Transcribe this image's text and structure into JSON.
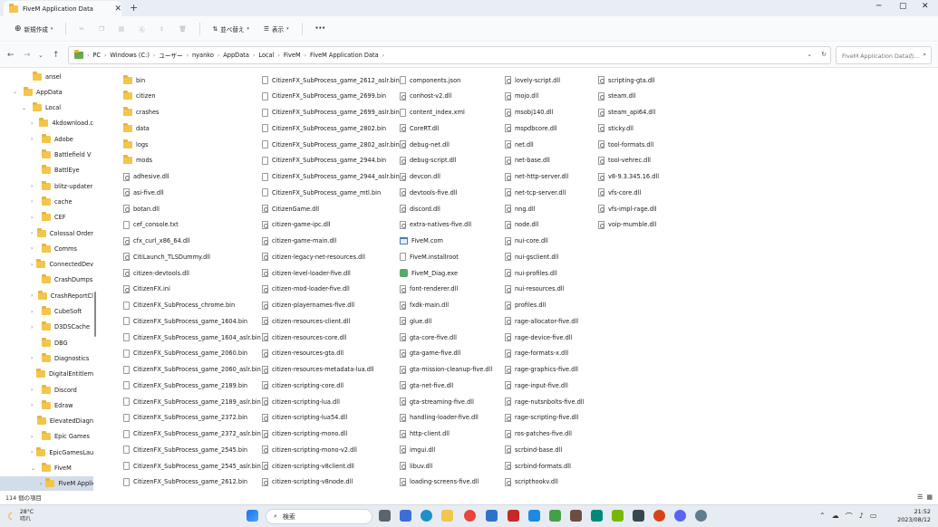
{
  "window": {
    "tab_title": "FiveM Application Data",
    "tab_close": "✕",
    "new_tab": "+",
    "minimize": "─",
    "maximize": "▢",
    "close": "✕"
  },
  "toolbar": {
    "new_label": "新規作成",
    "sort_label": "並べ替え",
    "view_label": "表示",
    "more": "···"
  },
  "address": {
    "crumbs": [
      "PC",
      "Windows (C:)",
      "ユーザー",
      "nyanko",
      "AppData",
      "Local",
      "FiveM",
      "FiveM Application Data"
    ],
    "search_placeholder": "FiveM Application Dataの..."
  },
  "sidebar": {
    "items": [
      {
        "label": "ansel",
        "level": 2,
        "expanded": false,
        "chev": false
      },
      {
        "label": "AppData",
        "level": 1,
        "expanded": true,
        "chev": true
      },
      {
        "label": "Local",
        "level": 2,
        "expanded": true,
        "chev": true
      },
      {
        "label": "4kdownload.c",
        "level": 3,
        "chev": true
      },
      {
        "label": "Adobe",
        "level": 3,
        "chev": true
      },
      {
        "label": "Battlefield V",
        "level": 3,
        "chev": false
      },
      {
        "label": "BattlEye",
        "level": 3,
        "chev": false
      },
      {
        "label": "blitz-updater",
        "level": 3,
        "chev": true
      },
      {
        "label": "cache",
        "level": 3,
        "chev": true
      },
      {
        "label": "CEF",
        "level": 3,
        "chev": true
      },
      {
        "label": "Colossal Order",
        "level": 3,
        "chev": true
      },
      {
        "label": "Comms",
        "level": 3,
        "chev": true
      },
      {
        "label": "ConnectedDev",
        "level": 3,
        "chev": true
      },
      {
        "label": "CrashDumps",
        "level": 3,
        "chev": false
      },
      {
        "label": "CrashReportCl",
        "level": 3,
        "chev": true
      },
      {
        "label": "CubeSoft",
        "level": 3,
        "chev": true
      },
      {
        "label": "D3DSCache",
        "level": 3,
        "chev": true
      },
      {
        "label": "DBG",
        "level": 3,
        "chev": false
      },
      {
        "label": "Diagnostics",
        "level": 3,
        "chev": true
      },
      {
        "label": "DigitalEntitlem",
        "level": 3,
        "chev": false
      },
      {
        "label": "Discord",
        "level": 3,
        "chev": true
      },
      {
        "label": "Edraw",
        "level": 3,
        "chev": true
      },
      {
        "label": "ElevatedDiagn",
        "level": 3,
        "chev": false
      },
      {
        "label": "Epic Games",
        "level": 3,
        "chev": true
      },
      {
        "label": "EpicGamesLau",
        "level": 3,
        "chev": true
      },
      {
        "label": "FiveM",
        "level": 3,
        "expanded": true,
        "chev": true
      },
      {
        "label": "FiveM Applic",
        "level": 4,
        "chev": true,
        "selected": true
      }
    ]
  },
  "files": {
    "columns": [
      [
        {
          "name": "bin",
          "type": "folder"
        },
        {
          "name": "citizen",
          "type": "folder"
        },
        {
          "name": "crashes",
          "type": "folder"
        },
        {
          "name": "data",
          "type": "folder"
        },
        {
          "name": "logs",
          "type": "folder"
        },
        {
          "name": "mods",
          "type": "folder"
        },
        {
          "name": "adhesive.dll",
          "type": "cfg"
        },
        {
          "name": "asi-five.dll",
          "type": "cfg"
        },
        {
          "name": "botan.dll",
          "type": "cfg"
        },
        {
          "name": "cef_console.txt",
          "type": "doc"
        },
        {
          "name": "cfx_curl_x86_64.dll",
          "type": "cfg"
        },
        {
          "name": "CitiLaunch_TLSDummy.dll",
          "type": "cfg"
        },
        {
          "name": "citizen-devtools.dll",
          "type": "cfg"
        },
        {
          "name": "CitizenFX.ini",
          "type": "cfg"
        },
        {
          "name": "CitizenFX_SubProcess_chrome.bin",
          "type": "doc"
        },
        {
          "name": "CitizenFX_SubProcess_game_1604.bin",
          "type": "doc"
        },
        {
          "name": "CitizenFX_SubProcess_game_1604_aslr.bin",
          "type": "doc"
        },
        {
          "name": "CitizenFX_SubProcess_game_2060.bin",
          "type": "doc"
        },
        {
          "name": "CitizenFX_SubProcess_game_2060_aslr.bin",
          "type": "doc"
        },
        {
          "name": "CitizenFX_SubProcess_game_2189.bin",
          "type": "doc"
        },
        {
          "name": "CitizenFX_SubProcess_game_2189_aslr.bin",
          "type": "doc"
        },
        {
          "name": "CitizenFX_SubProcess_game_2372.bin",
          "type": "doc"
        },
        {
          "name": "CitizenFX_SubProcess_game_2372_aslr.bin",
          "type": "doc"
        },
        {
          "name": "CitizenFX_SubProcess_game_2545.bin",
          "type": "doc"
        },
        {
          "name": "CitizenFX_SubProcess_game_2545_aslr.bin",
          "type": "doc"
        },
        {
          "name": "CitizenFX_SubProcess_game_2612.bin",
          "type": "doc"
        }
      ],
      [
        {
          "name": "CitizenFX_SubProcess_game_2612_aslr.bin",
          "type": "doc"
        },
        {
          "name": "CitizenFX_SubProcess_game_2699.bin",
          "type": "doc"
        },
        {
          "name": "CitizenFX_SubProcess_game_2699_aslr.bin",
          "type": "doc"
        },
        {
          "name": "CitizenFX_SubProcess_game_2802.bin",
          "type": "doc"
        },
        {
          "name": "CitizenFX_SubProcess_game_2802_aslr.bin",
          "type": "doc"
        },
        {
          "name": "CitizenFX_SubProcess_game_2944.bin",
          "type": "doc"
        },
        {
          "name": "CitizenFX_SubProcess_game_2944_aslr.bin",
          "type": "doc"
        },
        {
          "name": "CitizenFX_SubProcess_game_mtl.bin",
          "type": "doc"
        },
        {
          "name": "CitizenGame.dll",
          "type": "cfg"
        },
        {
          "name": "citizen-game-ipc.dll",
          "type": "cfg"
        },
        {
          "name": "citizen-game-main.dll",
          "type": "cfg"
        },
        {
          "name": "citizen-legacy-net-resources.dll",
          "type": "cfg"
        },
        {
          "name": "citizen-level-loader-five.dll",
          "type": "cfg"
        },
        {
          "name": "citizen-mod-loader-five.dll",
          "type": "cfg"
        },
        {
          "name": "citizen-playernames-five.dll",
          "type": "cfg"
        },
        {
          "name": "citizen-resources-client.dll",
          "type": "cfg"
        },
        {
          "name": "citizen-resources-core.dll",
          "type": "cfg"
        },
        {
          "name": "citizen-resources-gta.dll",
          "type": "cfg"
        },
        {
          "name": "citizen-resources-metadata-lua.dll",
          "type": "cfg"
        },
        {
          "name": "citizen-scripting-core.dll",
          "type": "cfg"
        },
        {
          "name": "citizen-scripting-lua.dll",
          "type": "cfg"
        },
        {
          "name": "citizen-scripting-lua54.dll",
          "type": "cfg"
        },
        {
          "name": "citizen-scripting-mono.dll",
          "type": "cfg"
        },
        {
          "name": "citizen-scripting-mono-v2.dll",
          "type": "cfg"
        },
        {
          "name": "citizen-scripting-v8client.dll",
          "type": "cfg"
        },
        {
          "name": "citizen-scripting-v8node.dll",
          "type": "cfg"
        }
      ],
      [
        {
          "name": "components.json",
          "type": "doc"
        },
        {
          "name": "conhost-v2.dll",
          "type": "cfg"
        },
        {
          "name": "content_index.xml",
          "type": "doc"
        },
        {
          "name": "CoreRT.dll",
          "type": "cfg"
        },
        {
          "name": "debug-net.dll",
          "type": "cfg"
        },
        {
          "name": "debug-script.dll",
          "type": "cfg"
        },
        {
          "name": "devcon.dll",
          "type": "cfg"
        },
        {
          "name": "devtools-five.dll",
          "type": "cfg"
        },
        {
          "name": "discord.dll",
          "type": "cfg"
        },
        {
          "name": "extra-natives-five.dll",
          "type": "cfg"
        },
        {
          "name": "FiveM.com",
          "type": "exe"
        },
        {
          "name": "FiveM.installroot",
          "type": "doc"
        },
        {
          "name": "FiveM_Diag.exe",
          "type": "app"
        },
        {
          "name": "font-renderer.dll",
          "type": "cfg"
        },
        {
          "name": "fxdk-main.dll",
          "type": "cfg"
        },
        {
          "name": "glue.dll",
          "type": "cfg"
        },
        {
          "name": "gta-core-five.dll",
          "type": "cfg"
        },
        {
          "name": "gta-game-five.dll",
          "type": "cfg"
        },
        {
          "name": "gta-mission-cleanup-five.dll",
          "type": "cfg"
        },
        {
          "name": "gta-net-five.dll",
          "type": "cfg"
        },
        {
          "name": "gta-streaming-five.dll",
          "type": "cfg"
        },
        {
          "name": "handling-loader-five.dll",
          "type": "cfg"
        },
        {
          "name": "http-client.dll",
          "type": "cfg"
        },
        {
          "name": "imgui.dll",
          "type": "cfg"
        },
        {
          "name": "libuv.dll",
          "type": "cfg"
        },
        {
          "name": "loading-screens-five.dll",
          "type": "cfg"
        }
      ],
      [
        {
          "name": "lovely-script.dll",
          "type": "cfg"
        },
        {
          "name": "mojo.dll",
          "type": "cfg"
        },
        {
          "name": "msobj140.dll",
          "type": "cfg"
        },
        {
          "name": "mspdbcore.dll",
          "type": "cfg"
        },
        {
          "name": "net.dll",
          "type": "cfg"
        },
        {
          "name": "net-base.dll",
          "type": "cfg"
        },
        {
          "name": "net-http-server.dll",
          "type": "cfg"
        },
        {
          "name": "net-tcp-server.dll",
          "type": "cfg"
        },
        {
          "name": "nng.dll",
          "type": "cfg"
        },
        {
          "name": "node.dll",
          "type": "cfg"
        },
        {
          "name": "nui-core.dll",
          "type": "cfg"
        },
        {
          "name": "nui-gsclient.dll",
          "type": "cfg"
        },
        {
          "name": "nui-profiles.dll",
          "type": "cfg"
        },
        {
          "name": "nui-resources.dll",
          "type": "cfg"
        },
        {
          "name": "profiles.dll",
          "type": "cfg"
        },
        {
          "name": "rage-allocator-five.dll",
          "type": "cfg"
        },
        {
          "name": "rage-device-five.dll",
          "type": "cfg"
        },
        {
          "name": "rage-formats-x.dll",
          "type": "cfg"
        },
        {
          "name": "rage-graphics-five.dll",
          "type": "cfg"
        },
        {
          "name": "rage-input-five.dll",
          "type": "cfg"
        },
        {
          "name": "rage-nutsnbolts-five.dll",
          "type": "cfg"
        },
        {
          "name": "rage-scripting-five.dll",
          "type": "cfg"
        },
        {
          "name": "ros-patches-five.dll",
          "type": "cfg"
        },
        {
          "name": "scrbind-base.dll",
          "type": "cfg"
        },
        {
          "name": "scrbind-formats.dll",
          "type": "cfg"
        },
        {
          "name": "scripthookv.dll",
          "type": "cfg"
        }
      ],
      [
        {
          "name": "scripting-gta.dll",
          "type": "cfg"
        },
        {
          "name": "steam.dll",
          "type": "cfg"
        },
        {
          "name": "steam_api64.dll",
          "type": "cfg"
        },
        {
          "name": "sticky.dll",
          "type": "cfg"
        },
        {
          "name": "tool-formats.dll",
          "type": "cfg"
        },
        {
          "name": "tool-vehrec.dll",
          "type": "cfg"
        },
        {
          "name": "v8-9.3.345.16.dll",
          "type": "cfg"
        },
        {
          "name": "vfs-core.dll",
          "type": "cfg"
        },
        {
          "name": "vfs-impl-rage.dll",
          "type": "cfg"
        },
        {
          "name": "voip-mumble.dll",
          "type": "cfg"
        }
      ]
    ]
  },
  "status": {
    "count": "114 個の項目"
  },
  "taskbar": {
    "temp": "28°C",
    "weather": "晴れ",
    "search": "検索",
    "time": "21:52",
    "date": "2023/08/12"
  }
}
